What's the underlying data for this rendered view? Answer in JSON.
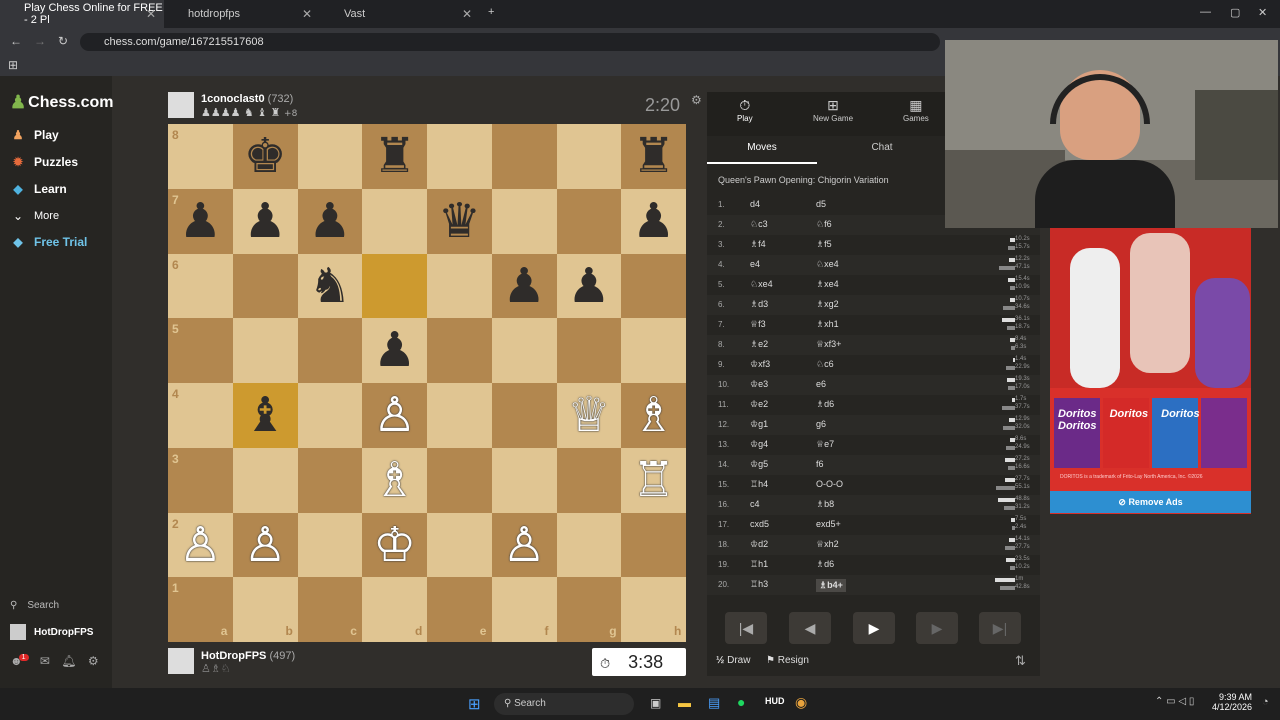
{
  "browser": {
    "tabs": [
      {
        "label": "Play Chess Online for FREE - 2 Pl",
        "active": true
      },
      {
        "label": "hotdropfps",
        "active": false
      },
      {
        "label": "Vast",
        "active": false
      }
    ],
    "url": "chess.com/game/167215517608"
  },
  "sidebar": {
    "logo": "Chess.com",
    "items": [
      {
        "label": "Play",
        "icon": "pawn-icon"
      },
      {
        "label": "Puzzles",
        "icon": "puzzle-icon"
      },
      {
        "label": "Learn",
        "icon": "graduation-icon"
      },
      {
        "label": "More",
        "icon": "chevron-down-icon"
      },
      {
        "label": "Free Trial",
        "icon": "diamond-icon"
      }
    ],
    "search": "Search",
    "username": "HotDropFPS",
    "notif_count": "1"
  },
  "opponent": {
    "name": "1conoclast0",
    "rating": "(732)",
    "captured": "♟♟♟♟ ♞ ♝ ♜",
    "advantage": "+8",
    "clock": "2:20"
  },
  "player": {
    "name": "HotDropFPS",
    "rating": "(497)",
    "captured": "♙♗♘",
    "clock": "3:38"
  },
  "board": {
    "ranks": [
      "8",
      "7",
      "6",
      "5",
      "4",
      "3",
      "2",
      "1"
    ],
    "files": [
      "a",
      "b",
      "c",
      "d",
      "e",
      "f",
      "g",
      "h"
    ]
  },
  "panel": {
    "tabs": [
      "Play",
      "New Game",
      "Games"
    ],
    "subtabs": [
      "Moves",
      "Chat"
    ],
    "opening": "Queen's Pawn Opening: Chigorin Variation",
    "moves": [
      [
        "1.",
        "d4",
        "d5"
      ],
      [
        "2.",
        "♘c3",
        "♘f6"
      ],
      [
        "3.",
        "♗f4",
        "♗f5"
      ],
      [
        "4.",
        "e4",
        "♘xe4"
      ],
      [
        "5.",
        "♘xe4",
        "♗xe4"
      ],
      [
        "6.",
        "♗d3",
        "♗xg2"
      ],
      [
        "7.",
        "♕f3",
        "♗xh1"
      ],
      [
        "8.",
        "♗e2",
        "♕xf3+"
      ],
      [
        "9.",
        "♔xf3",
        "♘c6"
      ],
      [
        "10.",
        "♔e3",
        "e6"
      ],
      [
        "11.",
        "♔e2",
        "♗d6"
      ],
      [
        "12.",
        "♔g1",
        "g6"
      ],
      [
        "13.",
        "♔g4",
        "♕e7"
      ],
      [
        "14.",
        "♔g5",
        "f6"
      ],
      [
        "15.",
        "♖h4",
        "O-O-O"
      ],
      [
        "16.",
        "c4",
        "♗b8"
      ],
      [
        "17.",
        "cxd5",
        "exd5+"
      ],
      [
        "18.",
        "♔d2",
        "♕xh2"
      ],
      [
        "19.",
        "♖h1",
        "♗d6"
      ],
      [
        "20.",
        "♖h3",
        "♗b4+"
      ]
    ],
    "times": [
      [
        "10.2s",
        "15.7s"
      ],
      [
        "12.2s",
        "47.1s"
      ],
      [
        "15.4s",
        "10.9s"
      ],
      [
        "10.7s",
        "34.6s"
      ],
      [
        "36.1s",
        "18.7s"
      ],
      [
        "8.4s",
        "6.3s"
      ],
      [
        "1.4s",
        "22.9s"
      ],
      [
        "19.3s",
        "17.0s"
      ],
      [
        "1.7s",
        "37.7s"
      ],
      [
        "12.9s",
        "32.0s"
      ],
      [
        "8.6s",
        "24.9s"
      ],
      [
        "27.2s",
        "16.6s"
      ],
      [
        "27.7s",
        "55.1s"
      ],
      [
        "48.8s",
        "31.2s"
      ],
      [
        "7.5s",
        "2.4s"
      ],
      [
        "14.1s",
        "27.7s"
      ],
      [
        "23.5s",
        "10.2s"
      ],
      [
        "1m",
        "42.8s"
      ]
    ],
    "draw": "Draw",
    "resign": "Resign"
  },
  "ad": {
    "brand": "Doritos",
    "disclaimer": "DORITOS is a trademark of Frito-Lay North America, Inc. ©2026",
    "remove": "Remove Ads"
  },
  "taskbar": {
    "search": "Search",
    "time": "9:39 AM",
    "date": "4/12/2026"
  },
  "colors": {
    "light": "#e0c592",
    "dark": "#b2874f",
    "accent": "#81b64c",
    "highlight": "#cd9a2f"
  }
}
